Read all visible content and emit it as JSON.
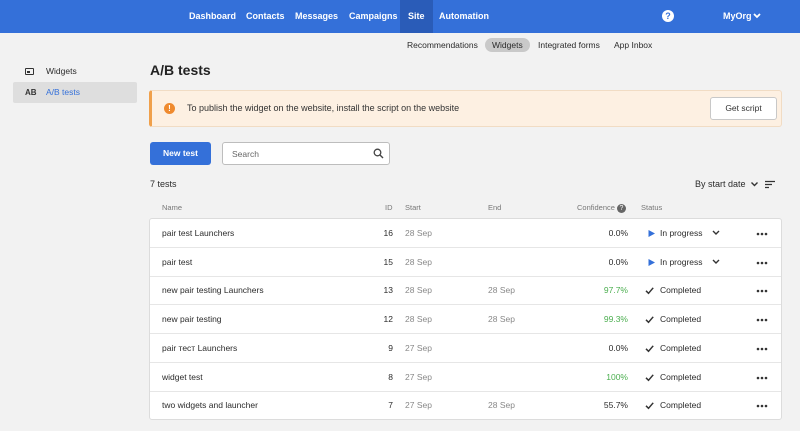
{
  "nav": {
    "items": [
      {
        "label": "Dashboard"
      },
      {
        "label": "Contacts"
      },
      {
        "label": "Messages"
      },
      {
        "label": "Campaigns"
      },
      {
        "label": "Site",
        "active": true
      },
      {
        "label": "Automation"
      }
    ],
    "help_icon": "?",
    "org": "MyOrg"
  },
  "subnav": [
    "Recommendations",
    "Widgets",
    "Integrated forms",
    "App Inbox"
  ],
  "sidebar": {
    "items": [
      {
        "label": "Widgets",
        "icon": "widget-icon"
      },
      {
        "label": "A/B tests",
        "icon_text": "AB",
        "active": true
      }
    ]
  },
  "page": {
    "title": "A/B tests",
    "alert": {
      "text": "To publish the widget on the website, install the script on the website",
      "button": "Get script",
      "icon": "!"
    },
    "new_test": "New test",
    "search_placeholder": "Search",
    "count": "7 tests",
    "sort": "By start date"
  },
  "table": {
    "headers": {
      "name": "Name",
      "id": "ID",
      "start": "Start",
      "end": "End",
      "confidence": "Confidence",
      "status": "Status"
    },
    "rows": [
      {
        "name": "pair test Launchers",
        "id": "16",
        "start": "28 Sep",
        "end": "",
        "confidence": "0.0%",
        "conf_green": false,
        "status": "In progress",
        "status_type": "progress"
      },
      {
        "name": "pair test",
        "id": "15",
        "start": "28 Sep",
        "end": "",
        "confidence": "0.0%",
        "conf_green": false,
        "status": "In progress",
        "status_type": "progress"
      },
      {
        "name": "new pair testing Launchers",
        "id": "13",
        "start": "28 Sep",
        "end": "28 Sep",
        "confidence": "97.7%",
        "conf_green": true,
        "status": "Completed",
        "status_type": "completed"
      },
      {
        "name": "new pair testing",
        "id": "12",
        "start": "28 Sep",
        "end": "28 Sep",
        "confidence": "99.3%",
        "conf_green": true,
        "status": "Completed",
        "status_type": "completed"
      },
      {
        "name": "pair тест Launchers",
        "id": "9",
        "start": "27 Sep",
        "end": "",
        "confidence": "0.0%",
        "conf_green": false,
        "status": "Completed",
        "status_type": "completed"
      },
      {
        "name": "widget test",
        "id": "8",
        "start": "27 Sep",
        "end": "",
        "confidence": "100%",
        "conf_green": true,
        "status": "Completed",
        "status_type": "completed"
      },
      {
        "name": "two widgets and launcher",
        "id": "7",
        "start": "27 Sep",
        "end": "28 Sep",
        "confidence": "55.7%",
        "conf_green": false,
        "status": "Completed",
        "status_type": "completed"
      }
    ]
  },
  "colors": {
    "brand": "#3470d9",
    "success": "#4caf50",
    "warning": "#ef8a2e"
  }
}
